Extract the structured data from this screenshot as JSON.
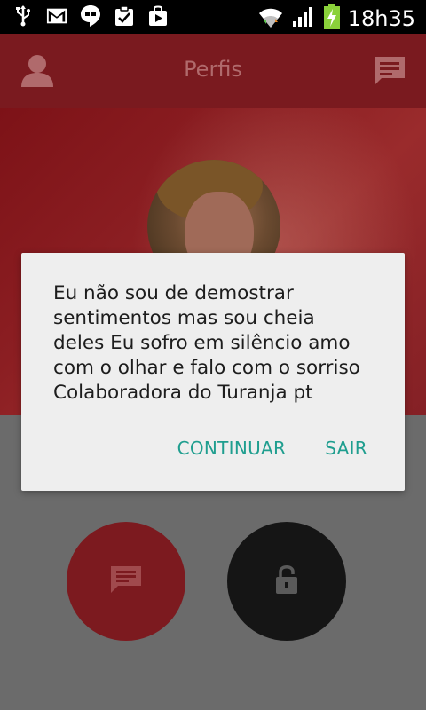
{
  "status_bar": {
    "time": "18h35",
    "icons": [
      "usb-icon",
      "gmail-icon",
      "hangouts-icon",
      "task-icon",
      "play-store-icon",
      "wifi-icon",
      "signal-icon",
      "battery-charging-icon"
    ]
  },
  "app_bar": {
    "title": "Perfis",
    "left_icon": "profile-icon",
    "right_icon": "message-icon"
  },
  "dialog": {
    "message": " Eu não sou de demostrar\nsentimentos  mas sou cheia\ndeles  Eu sofro em silêncio  amo\ncom o olhar e falo com o sorriso\nColaboradora do Turanja pt",
    "continue_label": "CONTINUAR",
    "exit_label": "SAIR"
  },
  "actions": {
    "message_button_icon": "message-icon",
    "lock_button_icon": "lock-icon"
  },
  "colors": {
    "accent_red": "#7c1a1f",
    "dialog_action": "#1f9e8f",
    "dark_button": "#151515"
  }
}
